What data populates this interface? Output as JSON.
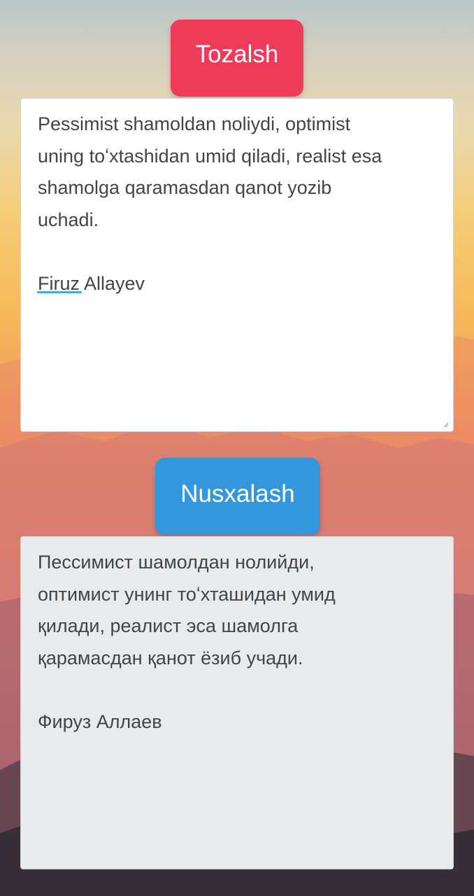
{
  "buttons": {
    "clear_label": "Tozalsh",
    "copy_label": "Nusxalash"
  },
  "input": {
    "text": "Pessimist shamoldan noliydi, optimist\nuning toʻxtashidan umid qiladi, realist esa\nshamolga qaramasdan qanot yozib\nuchadi.\n\nFiruz Allayev"
  },
  "output": {
    "text": "Пессимист шамолдан нолийди,\nоптимист унинг тоʻхташидан умид\nқилади, реалист эса шамолга\nқарамасдан қанот ёзиб учади.\n\nФируз Аллаев"
  },
  "colors": {
    "clear_button": "#f03a5a",
    "copy_button": "#3497dc",
    "input_background": "#ffffff",
    "output_background": "#e8eaec",
    "text": "#444444",
    "spellcheck_underline": "#3aaed8"
  },
  "icons": {
    "resize_handle": "resize-handle-icon"
  }
}
